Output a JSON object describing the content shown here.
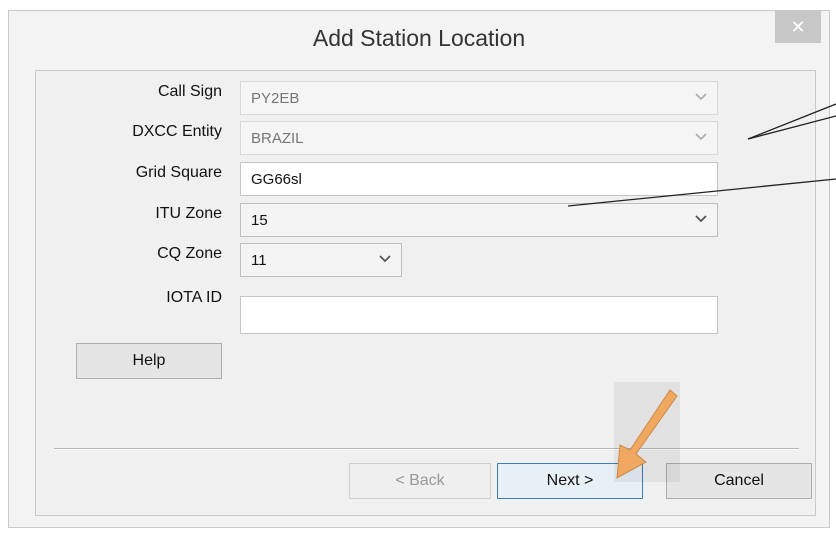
{
  "dialog": {
    "title": "Add Station Location",
    "close_glyph": "✕"
  },
  "form": {
    "call_sign": {
      "label": "Call Sign",
      "value": "PY2EB"
    },
    "dxcc_entity": {
      "label": "DXCC Entity",
      "value": "BRAZIL"
    },
    "grid_square": {
      "label": "Grid Square",
      "value": "GG66sl"
    },
    "itu_zone": {
      "label": "ITU Zone",
      "value": "15"
    },
    "cq_zone": {
      "label": "CQ Zone",
      "value": "11"
    },
    "iota_id": {
      "label": "IOTA ID",
      "value": ""
    }
  },
  "buttons": {
    "help": "Help",
    "back": "< Back",
    "next": "Next >",
    "cancel": "Cancel"
  },
  "icons": {
    "dropdown": "chevron-down-icon",
    "close": "close-icon",
    "pointer": "arrow-pointer-icon"
  },
  "colors": {
    "arrow": "#f0a860",
    "default_button_border": "#3c7fb1"
  }
}
